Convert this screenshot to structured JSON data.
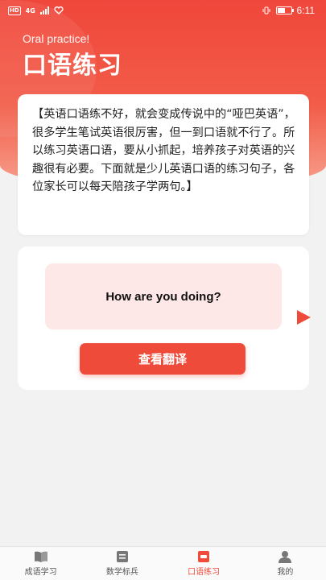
{
  "status_bar": {
    "hd": "HD",
    "network": "4G",
    "battery_icon": "battery-icon",
    "time": "6:11"
  },
  "header": {
    "subtitle": "Oral practice!",
    "title": "口语练习"
  },
  "intro": {
    "text": "【英语口语练不好，就会变成传说中的“哑巴英语”，很多学生笔试英语很厉害，但一到口语就不行了。所以练习英语口语，要从小抓起，培养孩子对英语的兴趣很有必要。下面就是少儿英语口语的练习句子，各位家长可以每天陪孩子学两句。】"
  },
  "practice": {
    "sentence": "How are you doing?",
    "translate_label": "查看翻译",
    "next_icon": "play-arrow-icon"
  },
  "tabs": [
    {
      "label": "成语学习",
      "icon": "book-icon",
      "active": false
    },
    {
      "label": "数学标兵",
      "icon": "document-icon",
      "active": false
    },
    {
      "label": "口语练习",
      "icon": "chat-icon",
      "active": true
    },
    {
      "label": "我的",
      "icon": "user-icon",
      "active": false
    }
  ],
  "colors": {
    "accent": "#ef4b3b",
    "sentence_bg": "#fde7e7",
    "page_bg": "#f2f2f2"
  }
}
